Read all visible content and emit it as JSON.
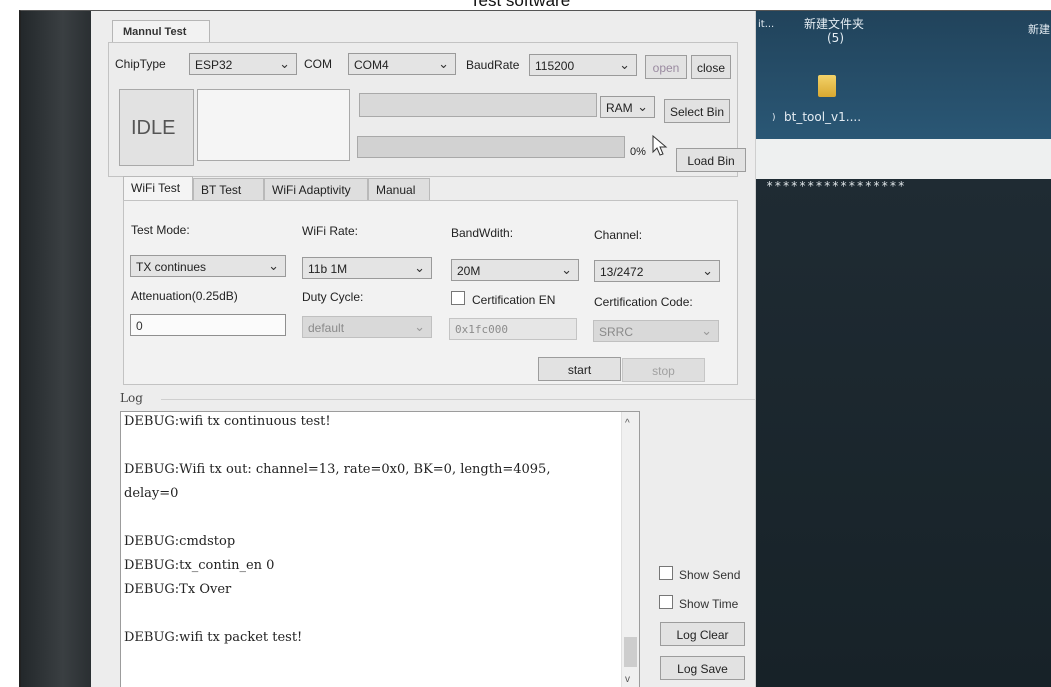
{
  "caption": "Test software",
  "desktop": {
    "folder_label": "新建文件夹",
    "folder_count": "(5)",
    "right_label": "新建",
    "edge_label": "it...",
    "file_label": "bt_tool_v1....",
    "stars": "*****************"
  },
  "window": {
    "top_tab": "Mannul Test",
    "chip_label": "ChipType",
    "chip_value": "ESP32",
    "com_label": "COM",
    "com_value": "COM4",
    "baud_label": "BaudRate",
    "baud_value": "115200",
    "open_label": "open",
    "close_label": "close",
    "status": "IDLE",
    "mem_value": "RAM",
    "select_bin": "Select Bin",
    "load_bin": "Load Bin",
    "progress_text": "0%",
    "progress": 0
  },
  "tabs": [
    "WiFi Test",
    "BT Test",
    "WiFi Adaptivity",
    "Manual"
  ],
  "wifi": {
    "test_mode_label": "Test Mode:",
    "test_mode_value": "TX continues",
    "rate_label": "WiFi Rate:",
    "rate_value": "11b 1M",
    "bw_label": "BandWdith:",
    "bw_value": "20M",
    "channel_label": "Channel:",
    "channel_value": "13/2472",
    "atten_label": "Attenuation(0.25dB)",
    "atten_value": "0",
    "duty_label": "Duty Cycle:",
    "duty_value": "default",
    "cert_en_label": "Certification EN",
    "cert_en_value": "0x1fc000",
    "cert_code_label": "Certification Code:",
    "cert_code_value": "SRRC",
    "start": "start",
    "stop": "stop"
  },
  "log": {
    "title": "Log",
    "lines": [
      "DEBUG:wifi tx continuous test!",
      "",
      "DEBUG:Wifi tx out: channel=13, rate=0x0, BK=0, length=4095,",
      "delay=0",
      "",
      "DEBUG:cmdstop",
      "DEBUG:tx_contin_en 0",
      "DEBUG:Tx Over",
      "",
      "DEBUG:wifi tx packet test!"
    ],
    "show_send": "Show Send",
    "show_time": "Show Time",
    "clear": "Log Clear",
    "save": "Log Save"
  }
}
